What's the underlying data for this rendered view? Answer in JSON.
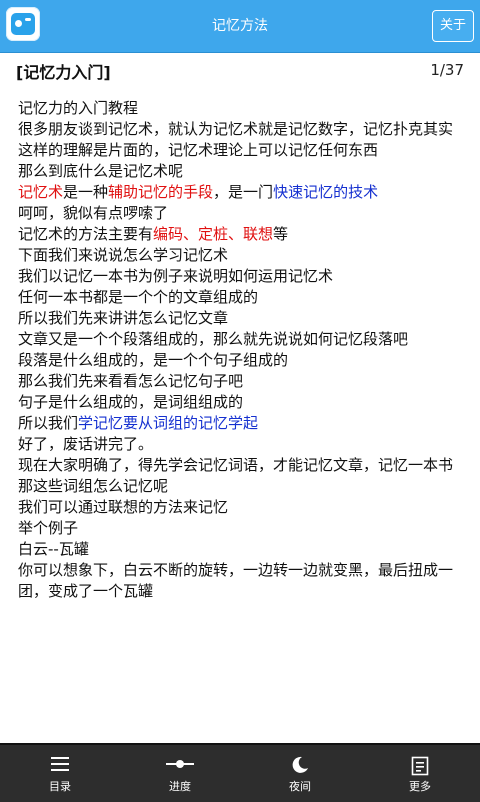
{
  "header": {
    "title": "记忆方法",
    "about_label": "关于"
  },
  "content": {
    "chapter_title": "[记忆力入门]",
    "page_indicator": "1/37",
    "paragraphs": [
      [
        {
          "t": "记忆力的入门教程"
        }
      ],
      [
        {
          "t": " "
        }
      ],
      [
        {
          "t": "很多朋友谈到记忆术，就认为记忆术就是记忆数字，记忆扑克其实这样的理解是片面的，记忆术理论上可以记忆任何东西"
        }
      ],
      [
        {
          "t": " "
        }
      ],
      [
        {
          "t": "那么到底什么是记忆术呢"
        }
      ],
      [
        {
          "t": "记忆术",
          "c": "red"
        },
        {
          "t": "是一种"
        },
        {
          "t": "辅助记忆的手段",
          "c": "red"
        },
        {
          "t": "，是一门"
        },
        {
          "t": "快速记忆的技术",
          "c": "blue"
        }
      ],
      [
        {
          "t": "呵呵，貌似有点啰嗦了"
        }
      ],
      [
        {
          "t": "记忆术的方法主要有"
        },
        {
          "t": "编码、定桩、联想",
          "c": "red"
        },
        {
          "t": "等"
        }
      ],
      [
        {
          "t": " "
        }
      ],
      [
        {
          "t": "下面我们来说说怎么学习记忆术"
        }
      ],
      [
        {
          "t": "我们以记忆一本书为例子来说明如何运用记忆术"
        }
      ],
      [
        {
          "t": "任何一本书都是一个个的文章组成的"
        }
      ],
      [
        {
          "t": "所以我们先来讲讲怎么记忆文章"
        }
      ],
      [
        {
          "t": "文章又是一个个段落组成的，那么就先说说如何记忆段落吧"
        }
      ],
      [
        {
          "t": "段落是什么组成的，是一个个句子组成的"
        }
      ],
      [
        {
          "t": "那么我们先来看看怎么记忆句子吧"
        }
      ],
      [
        {
          "t": "句子是什么组成的，是词组组成的"
        }
      ],
      [
        {
          "t": "所以我们"
        },
        {
          "t": "学记忆要从词组的记忆学起",
          "c": "blue"
        }
      ],
      [
        {
          "t": " "
        }
      ],
      [
        {
          "t": "好了，废话讲完了。"
        }
      ],
      [
        {
          "t": "现在大家明确了，得先学会记忆词语，才能记忆文章，记忆一本书"
        }
      ],
      [
        {
          "t": "那这些词组怎么记忆呢"
        }
      ],
      [
        {
          "t": "我们可以通过联想的方法来记忆"
        }
      ],
      [
        {
          "t": "举个例子"
        }
      ],
      [
        {
          "t": "白云--瓦罐"
        }
      ],
      [
        {
          "t": "你可以想象下，白云不断的旋转，一边转一边就变黑，最后扭成一团，变成了一个瓦罐"
        }
      ]
    ]
  },
  "bottom_nav": [
    {
      "label": "目录",
      "icon": "list-icon"
    },
    {
      "label": "进度",
      "icon": "progress-slider-icon"
    },
    {
      "label": "夜间",
      "icon": "moon-icon"
    },
    {
      "label": "更多",
      "icon": "more-document-icon"
    }
  ]
}
